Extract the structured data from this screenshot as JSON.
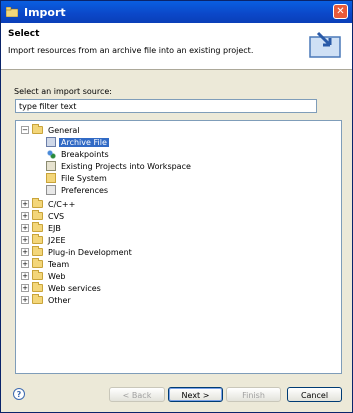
{
  "window": {
    "title": "Import",
    "close_label": "✕"
  },
  "header": {
    "title": "Select",
    "description": "Import resources from an archive file into an existing project."
  },
  "source": {
    "label": "Select an import source:"
  },
  "filter": {
    "value": "type filter text"
  },
  "tree": {
    "items": [
      {
        "label": "General",
        "expanded": true,
        "children": [
          "Archive File",
          "Breakpoints",
          "Existing Projects into Workspace",
          "File System",
          "Preferences"
        ]
      },
      {
        "label": "C/C++"
      },
      {
        "label": "CVS"
      },
      {
        "label": "EJB"
      },
      {
        "label": "J2EE"
      },
      {
        "label": "Plug-in Development"
      },
      {
        "label": "Team"
      },
      {
        "label": "Web"
      },
      {
        "label": "Web services"
      },
      {
        "label": "Other"
      }
    ],
    "selected": "Archive File",
    "expand_glyph": "+",
    "collapse_glyph": "−"
  },
  "buttons": {
    "back": "< Back",
    "next": "Next >",
    "finish": "Finish",
    "cancel": "Cancel",
    "help": "?"
  }
}
